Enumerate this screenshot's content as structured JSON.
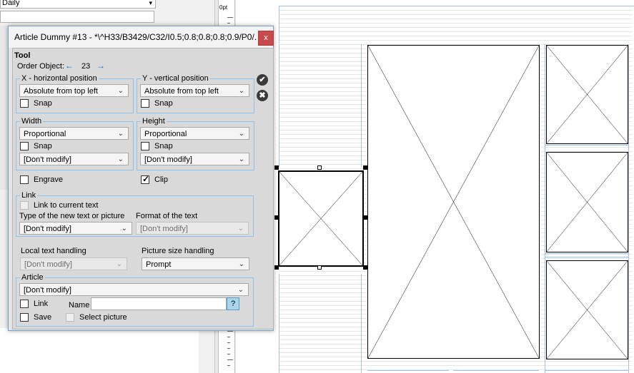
{
  "background": {
    "frequency_select": "Daily",
    "ruler_unit": "0pt"
  },
  "dialog": {
    "title": "Article Dummy #13 - *\\^H33/B3429/C32/I0.5;0.8;0.8;0.8;0.9/P0/...",
    "close_label": "x",
    "tool_heading": "Tool",
    "order_object": {
      "label": "Order Object:",
      "value": "23",
      "left_arrow": "←",
      "right_arrow": "→"
    },
    "ok_label": "✔",
    "cancel_label": "✖",
    "x_position": {
      "label": "X - horizontal position",
      "mode": "Absolute from top left",
      "snap_label": "Snap",
      "snap_checked": false
    },
    "y_position": {
      "label": "Y - vertical position",
      "mode": "Absolute from top left",
      "snap_label": "Snap",
      "snap_checked": false
    },
    "width": {
      "label": "Width",
      "mode": "Proportional",
      "snap_label": "Snap",
      "modify": "[Don't modify]"
    },
    "height": {
      "label": "Height",
      "mode": "Proportional",
      "snap_label": "Snap",
      "modify": "[Don't modify]"
    },
    "engrave_label": "Engrave",
    "clip_label": "Clip",
    "clip_checked": true,
    "link": {
      "label": "Link",
      "link_current_label": "Link to current text",
      "type_label": "Type of the new text or picture",
      "type_value": "[Don't modify]",
      "format_label": "Format of the text",
      "format_value": "[Don't modify]"
    },
    "local_text": {
      "label": "Local text handling",
      "value": "[Don't modify]"
    },
    "picture_size": {
      "label": "Picture size handling",
      "value": "Prompt"
    },
    "article": {
      "label": "Article",
      "value": "[Don't modify]",
      "link_label": "Link",
      "name_label": "Name",
      "name_value": "",
      "help_label": "?",
      "save_label": "Save",
      "select_picture_label": "Select picture"
    }
  }
}
